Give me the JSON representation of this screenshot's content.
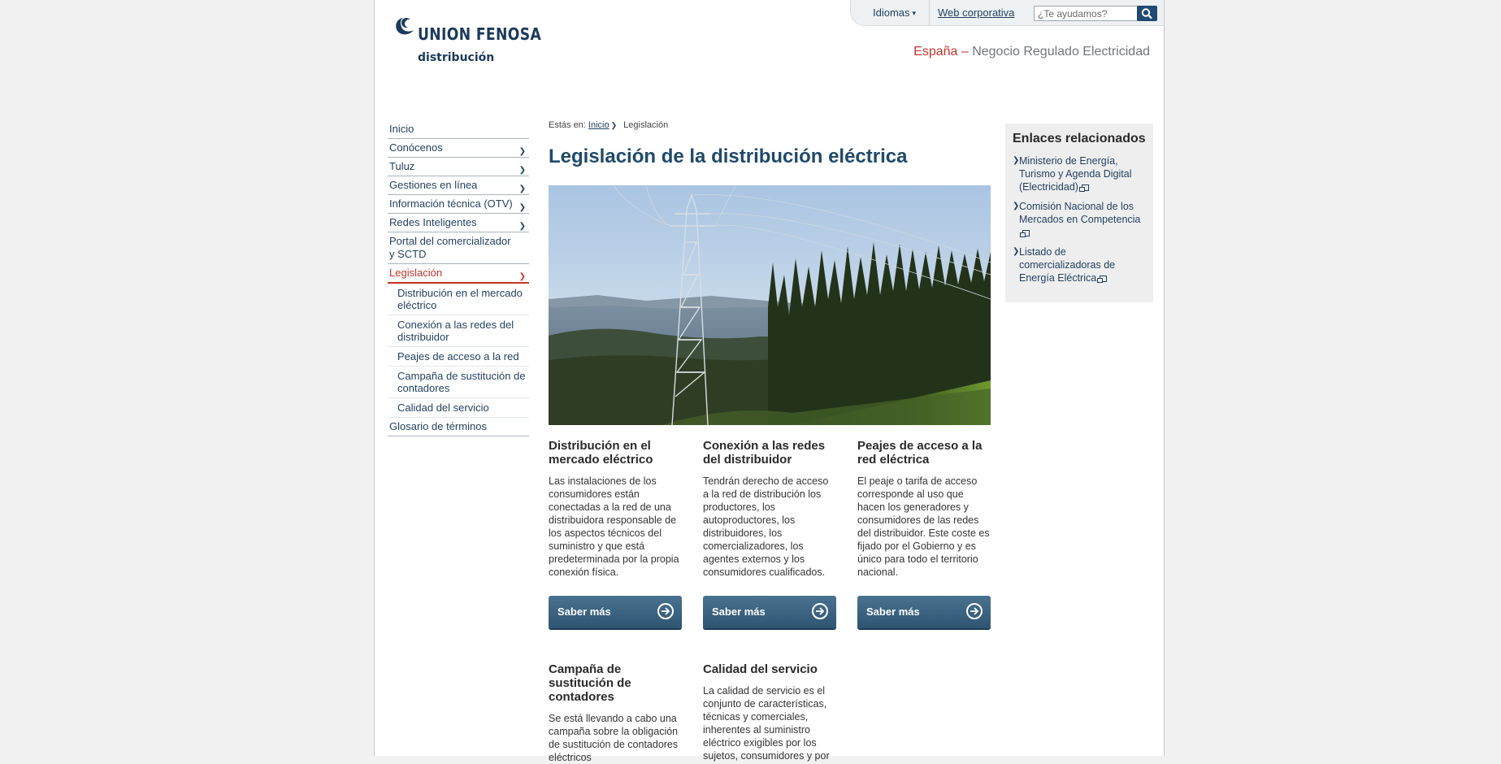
{
  "brand": {
    "name": "UNION FENOSA",
    "sub": "distribución"
  },
  "topbar": {
    "languages_label": "Idiomas",
    "corporate_link": "Web corporativa",
    "search_placeholder": "¿Te ayudamos?"
  },
  "tagline": {
    "country": "España",
    "dash": " – ",
    "text": "Negocio Regulado Electricidad"
  },
  "nav": {
    "items": [
      {
        "label": "Inicio"
      },
      {
        "label": "Conócenos"
      },
      {
        "label": "Tuluz"
      },
      {
        "label": "Gestiones en línea"
      },
      {
        "label": "Información técnica (OTV)"
      },
      {
        "label": "Redes Inteligentes"
      },
      {
        "label": "Portal del comercializador y SCTD"
      },
      {
        "label": "Legislación"
      },
      {
        "label": "Glosario de términos"
      }
    ],
    "subitems": [
      {
        "label": "Distribución en el mercado eléctrico"
      },
      {
        "label": "Conexión a las redes del distribuidor"
      },
      {
        "label": "Peajes de acceso a la red"
      },
      {
        "label": "Campaña de sustitución de contadores"
      },
      {
        "label": "Calidad del servicio"
      }
    ]
  },
  "breadcrumb": {
    "prefix": "Estás en:",
    "home": "Inicio",
    "current": "Legislación"
  },
  "main": {
    "title": "Legislación de la distribución eléctrica",
    "cards": [
      {
        "title": "Distribución en el mercado eléctrico",
        "text": "Las instalaciones de los consumidores están conectadas a la red de una distribuidora responsable de los aspectos técnicos del suministro y que está predeterminada por la propia conexión física.",
        "button": "Saber más"
      },
      {
        "title": "Conexión a las redes del distribuidor",
        "text": "Tendrán derecho de acceso a la red de distribución los productores, los autoproductores, los distribuidores, los comercializadores, los agentes externos y los consumidores cualificados.",
        "button": "Saber más"
      },
      {
        "title": "Peajes de acceso a la red eléctrica",
        "text": "El peaje o tarifa de acceso corresponde al uso que hacen los generadores y consumidores de las redes del distribuidor. Este coste es fijado por el Gobierno y es único para todo el territorio nacional.",
        "button": "Saber más"
      },
      {
        "title": "Campaña de sustitución de contadores",
        "text": "Se está llevando a cabo una campaña sobre la obligación de sustitución de contadores eléctricos"
      },
      {
        "title": "Calidad del servicio",
        "text": "La calidad de servicio es el conjunto de características, técnicas y comerciales, inherentes al suministro eléctrico exigibles por los sujetos, consumidores y por"
      }
    ]
  },
  "related": {
    "title": "Enlaces relacionados",
    "links": [
      {
        "label": "Ministerio de Energía, Turismo y Agenda Digital (Electricidad)"
      },
      {
        "label": "Comisión Nacional de los Mercados en Competencia"
      },
      {
        "label": "Listado de comercializadoras de Energía Eléctrica"
      }
    ]
  },
  "icons": {
    "search": "search-icon",
    "arrow": "arrow-right-circle-icon",
    "chevron": "chevron-right-icon",
    "external": "external-link-icon"
  },
  "colors": {
    "brand_navy": "#1b3a5c",
    "link_blue": "#1f3f5f",
    "accent_red": "#c2352f",
    "button_blue": "#2e5472"
  }
}
